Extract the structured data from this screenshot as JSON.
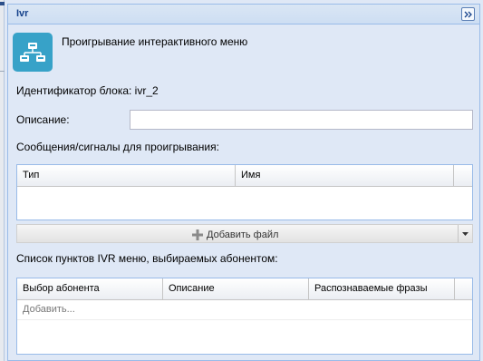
{
  "window": {
    "title": "Ivr"
  },
  "block": {
    "title": "Проигрывание интерактивного меню",
    "id_text": "Идентификатор блока: ivr_2"
  },
  "description": {
    "label": "Описание:",
    "value": ""
  },
  "messages": {
    "label": "Сообщения/сигналы для проигрывания:",
    "columns": [
      "Тип",
      "Имя"
    ],
    "add_file_label": "Добавить файл"
  },
  "menu_items": {
    "label": "Список пунктов IVR меню, выбираемых абонентом:",
    "columns": [
      "Выбор абонента",
      "Описание",
      "Распознаваемые фразы"
    ],
    "add_row_label": "Добавить..."
  },
  "colors": {
    "header_text": "#15428b",
    "icon_bg": "#37a2c8",
    "panel_bg": "#dfe8f6"
  }
}
